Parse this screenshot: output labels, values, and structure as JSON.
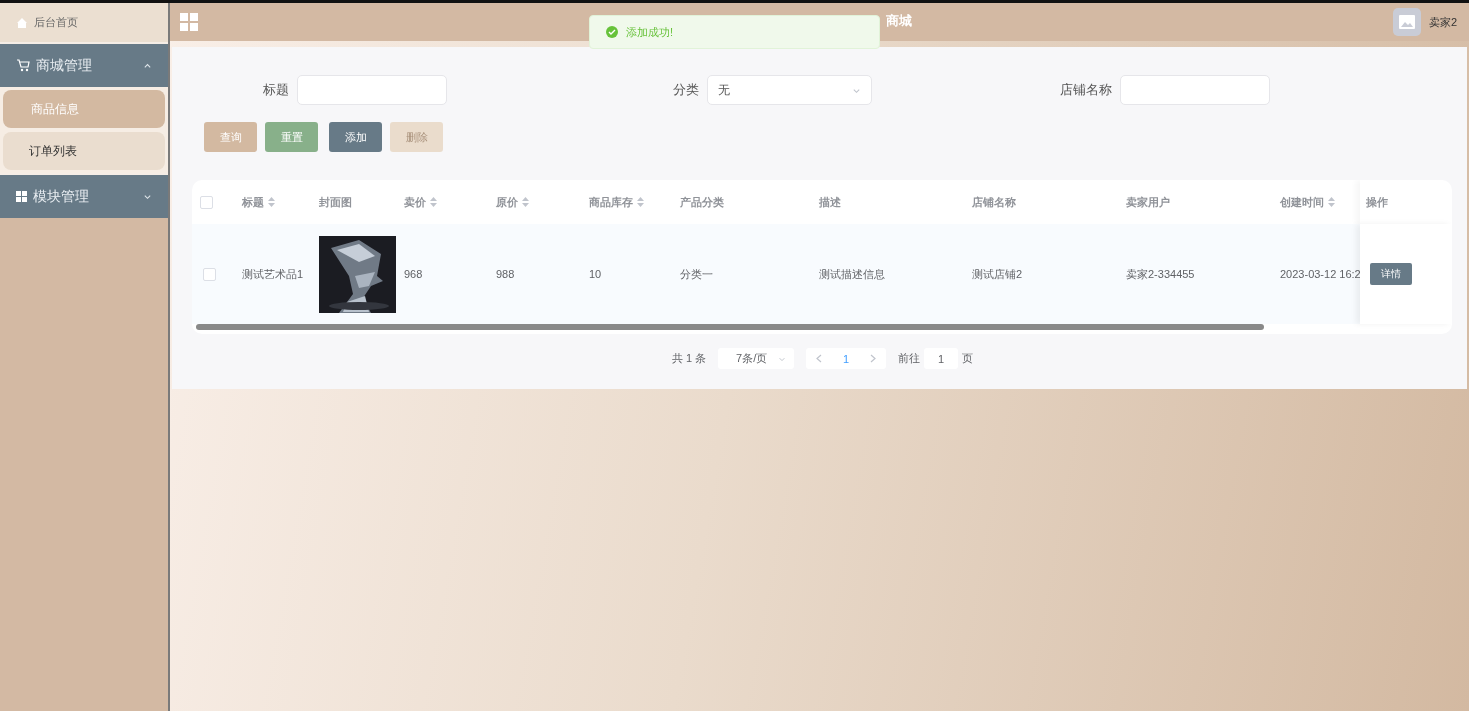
{
  "sidebar": {
    "home": {
      "label": "后台首页"
    },
    "menus": [
      {
        "label": "商城管理",
        "expanded": true,
        "items": [
          {
            "label": "商品信息",
            "selected": true
          },
          {
            "label": "订单列表",
            "selected": false
          }
        ]
      },
      {
        "label": "模块管理",
        "expanded": false
      }
    ]
  },
  "header": {
    "title": "商城",
    "user": "卖家2"
  },
  "toast": {
    "message": "添加成功!"
  },
  "filters": [
    {
      "label": "标题",
      "kind": "input"
    },
    {
      "label": "分类",
      "kind": "select",
      "value": "无"
    },
    {
      "label": "店铺名称",
      "kind": "input"
    }
  ],
  "actions": [
    {
      "label": "查询",
      "kind": "search",
      "disabled": false
    },
    {
      "label": "重置",
      "kind": "reset",
      "disabled": false
    },
    {
      "label": "添加",
      "kind": "add",
      "disabled": false
    },
    {
      "label": "删除",
      "kind": "delete",
      "disabled": true
    }
  ],
  "table": {
    "all_checked": false,
    "columns": [
      {
        "label": "标题",
        "sortable": true
      },
      {
        "label": "封面图",
        "sortable": false
      },
      {
        "label": "卖价",
        "sortable": true
      },
      {
        "label": "原价",
        "sortable": true
      },
      {
        "label": "商品库存",
        "sortable": true
      },
      {
        "label": "产品分类",
        "sortable": false
      },
      {
        "label": "描述",
        "sortable": false
      },
      {
        "label": "店铺名称",
        "sortable": false
      },
      {
        "label": "卖家用户",
        "sortable": false
      },
      {
        "label": "创建时间",
        "sortable": true
      },
      {
        "label": "操作",
        "sortable": false
      }
    ],
    "rows": [
      {
        "checked": false,
        "cells": [
          {
            "kind": "text",
            "text": "测试艺术品1"
          },
          {
            "kind": "picture"
          },
          {
            "kind": "text",
            "text": "968"
          },
          {
            "kind": "text",
            "text": "988"
          },
          {
            "kind": "text",
            "text": "10"
          },
          {
            "kind": "text",
            "text": "分类一"
          },
          {
            "kind": "text",
            "text": "测试描述信息"
          },
          {
            "kind": "text",
            "text": "测试店铺2"
          },
          {
            "kind": "text",
            "text": "卖家2-334455"
          },
          {
            "kind": "text",
            "text": "2023-03-12 16:2"
          },
          {
            "kind": "button",
            "text": "详情"
          }
        ]
      }
    ]
  },
  "pagination": {
    "total": "共 1 条",
    "page_size": "7条/页",
    "pages": [
      {
        "label": "1",
        "selected": true
      }
    ],
    "goto_label": "前往",
    "goto_value": "1",
    "goto_suffix": "页"
  }
}
